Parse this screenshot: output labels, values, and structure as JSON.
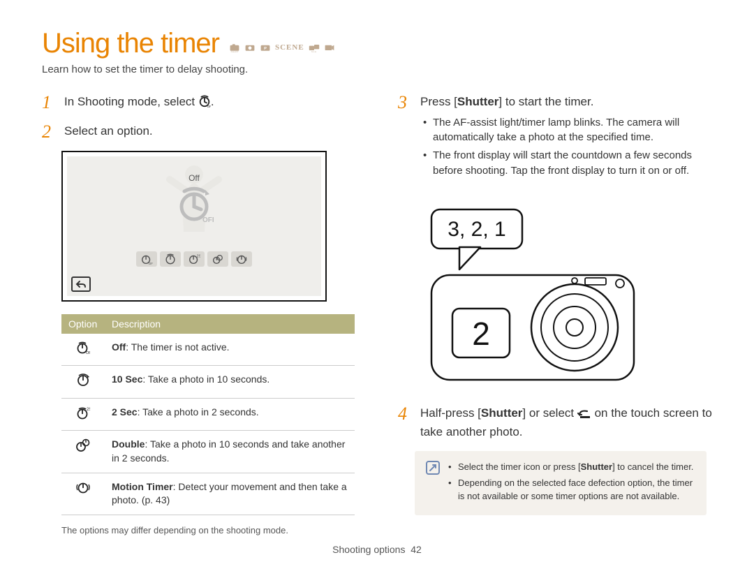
{
  "title": "Using the timer",
  "subtitle": "Learn how to set the timer to delay shooting.",
  "mode_icons": [
    "smart-auto",
    "camera",
    "camera-p",
    "scene",
    "dual",
    "movie"
  ],
  "left": {
    "step1_text": "In Shooting mode, select",
    "step1_icon": "timer-off-icon",
    "step2_text": "Select an option.",
    "lcd": {
      "off_label": "Off",
      "big_icon_sub": "OFF"
    }
  },
  "options_table": {
    "headers": {
      "option": "Option",
      "description": "Description"
    },
    "rows": [
      {
        "icon": "timer-off-icon",
        "bold": "Off",
        "rest": ": The timer is not active."
      },
      {
        "icon": "timer-10-icon",
        "bold": "10 Sec",
        "rest": ": Take a photo in 10 seconds."
      },
      {
        "icon": "timer-2-icon",
        "bold": "2 Sec",
        "rest": ": Take a photo in 2 seconds."
      },
      {
        "icon": "timer-double-icon",
        "bold": "Double",
        "rest": ": Take a photo in 10 seconds and take another in 2 seconds."
      },
      {
        "icon": "motion-timer-icon",
        "bold": "Motion Timer",
        "rest": ": Detect your movement and then take a photo. (p. 43)"
      }
    ],
    "footnote": "The options may differ depending on the shooting mode."
  },
  "right": {
    "step3_pre": "Press [",
    "step3_bold": "Shutter",
    "step3_post": "] to start the timer.",
    "step3_bullets": [
      "The AF-assist light/timer lamp blinks. The camera will automatically take a photo at the specified time.",
      "The front display will start the countdown a few seconds before shooting. Tap the front display to turn it on or off."
    ],
    "camera": {
      "bubble_text": "3, 2, 1",
      "front_display_text": "2"
    },
    "step4_pre": "Half-press [",
    "step4_bold": "Shutter",
    "step4_mid": "] or select ",
    "step4_icon": "back-curved-arrow-icon",
    "step4_post": " on the touch screen to take another photo.",
    "note": {
      "items": [
        {
          "pre": "Select the timer icon or press [",
          "bold": "Shutter",
          "post": "] to cancel the timer."
        },
        {
          "text": "Depending on the selected face defection option, the timer is not available or some timer options are not available."
        }
      ]
    }
  },
  "footer": {
    "section": "Shooting options",
    "page": "42"
  }
}
